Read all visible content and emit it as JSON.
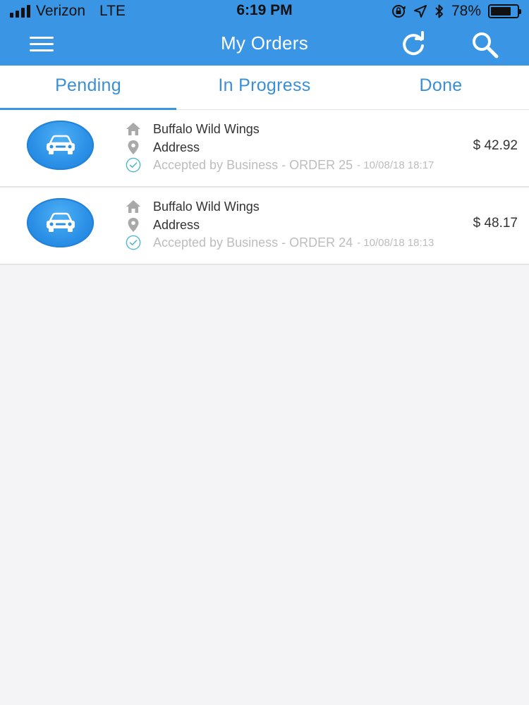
{
  "status_bar": {
    "carrier": "Verizon",
    "network": "LTE",
    "time": "6:19 PM",
    "battery_percent": "78%",
    "battery_level": 0.78
  },
  "header": {
    "title": "My Orders",
    "menu_icon": "hamburger-menu-icon",
    "refresh_icon": "refresh-icon",
    "search_icon": "search-icon",
    "background_color": "#3a95e5"
  },
  "tabs": [
    {
      "label": "Pending",
      "active": true
    },
    {
      "label": "In Progress",
      "active": false
    },
    {
      "label": "Done",
      "active": false
    }
  ],
  "orders": [
    {
      "business": "Buffalo Wild Wings",
      "address": "Address",
      "status": "Accepted by Business - ORDER 25",
      "timestamp": " - 10/08/18 18:17",
      "price": "$ 42.92"
    },
    {
      "business": "Buffalo Wild Wings",
      "address": "Address",
      "status": "Accepted by Business - ORDER 24",
      "timestamp": " - 10/08/18 18:13",
      "price": "$ 48.17"
    }
  ],
  "colors": {
    "accent": "#3a95e5",
    "tab_text": "#3a8fd6",
    "muted_text": "#bdbdbd",
    "check_icon": "#49b6c9"
  }
}
